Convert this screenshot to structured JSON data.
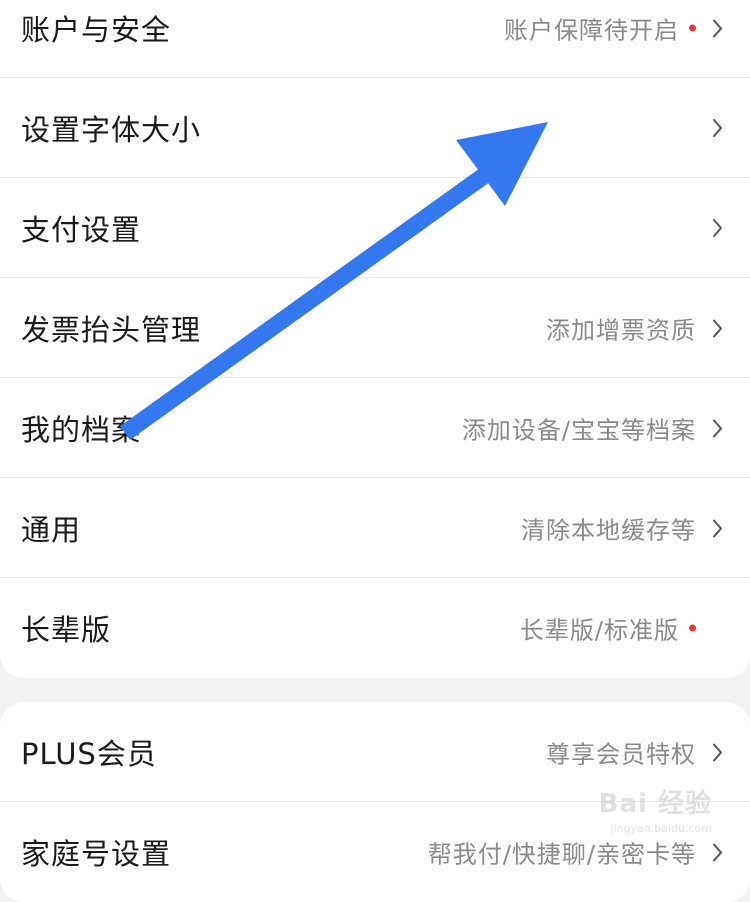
{
  "settings_group_1": [
    {
      "label": "账户与安全",
      "value": "账户保障待开启",
      "dot": true,
      "chevron": true
    },
    {
      "label": "设置字体大小",
      "value": "",
      "dot": false,
      "chevron": true
    },
    {
      "label": "支付设置",
      "value": "",
      "dot": false,
      "chevron": true
    },
    {
      "label": "发票抬头管理",
      "value": "添加增票资质",
      "dot": false,
      "chevron": true
    },
    {
      "label": "我的档案",
      "value": "添加设备/宝宝等档案",
      "dot": false,
      "chevron": true
    },
    {
      "label": "通用",
      "value": "清除本地缓存等",
      "dot": false,
      "chevron": true
    },
    {
      "label": "长辈版",
      "value": "长辈版/标准版",
      "dot": true,
      "chevron": false
    }
  ],
  "settings_group_2": [
    {
      "label": "PLUS会员",
      "value": "尊享会员特权",
      "dot": false,
      "chevron": true
    },
    {
      "label": "家庭号设置",
      "value": "帮我付/快捷聊/亲密卡等",
      "dot": false,
      "chevron": true
    }
  ],
  "colors": {
    "annotation_arrow": "#3478f0",
    "badge_dot": "#e23a3a",
    "background": "#f2f2f2"
  },
  "watermark": {
    "brand": "Bai 经验",
    "url": "jingyan.baidu.com"
  }
}
